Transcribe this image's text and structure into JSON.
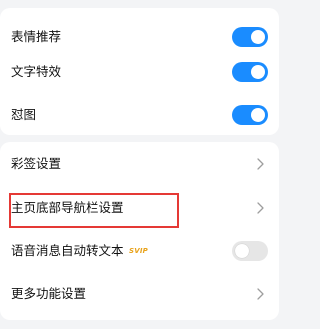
{
  "toggles_section": {
    "items": [
      {
        "label": "表情推荐",
        "state": "on"
      },
      {
        "label": "文字特效",
        "state": "on"
      },
      {
        "label": "怼图",
        "state": "on"
      }
    ]
  },
  "settings_section": {
    "items": [
      {
        "label": "彩签设置",
        "control": "chevron"
      },
      {
        "label": "主页底部导航栏设置",
        "control": "chevron",
        "highlighted": true
      },
      {
        "label": "语音消息自动转文本",
        "control": "toggle",
        "state": "off",
        "badge": "SVIP"
      },
      {
        "label": "更多功能设置",
        "control": "chevron"
      }
    ]
  },
  "colors": {
    "background": "#f3f4f6",
    "card": "#ffffff",
    "toggle_on": "#1a8cff",
    "toggle_off": "#e6e6e6",
    "highlight_border": "#e53935",
    "badge": "#e8a21a"
  }
}
